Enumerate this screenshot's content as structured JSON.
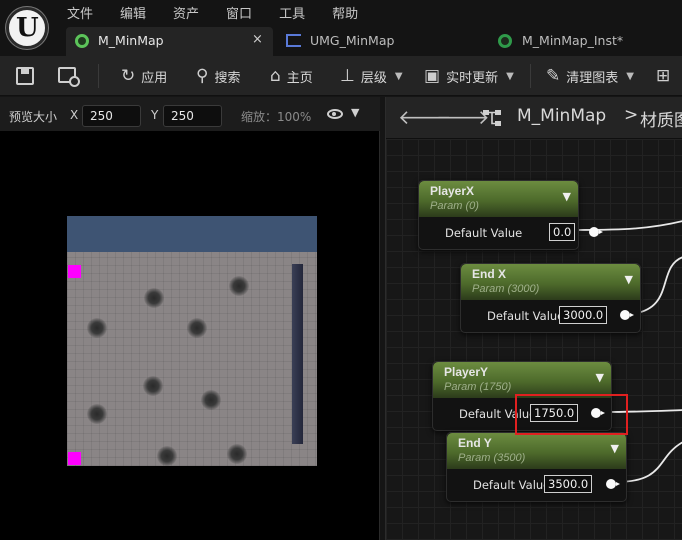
{
  "menu": [
    "文件",
    "编辑",
    "资产",
    "窗口",
    "工具",
    "帮助"
  ],
  "tabs": [
    {
      "label": "M_MinMap",
      "close": "×"
    },
    {
      "label": "UMG_MinMap"
    },
    {
      "label": "M_MinMap_Inst*"
    }
  ],
  "toolbar": {
    "apply": "应用",
    "search": "搜索",
    "home": "主页",
    "hierarchy": "层级",
    "live_update": "实时更新",
    "clean_graph": "清理图表"
  },
  "viewport": {
    "preview_size_label": "预览大小",
    "x_label": "X",
    "x_value": "250",
    "y_label": "Y",
    "y_value": "250",
    "zoom_label": "缩放：100%"
  },
  "graph": {
    "breadcrumb_asset": "M_MinMap",
    "breadcrumb_sep": ">",
    "breadcrumb_graph": "材质图"
  },
  "nodes": [
    {
      "name": "PlayerX",
      "sub": "Param (0)",
      "default_label": "Default Value",
      "value": "0.0"
    },
    {
      "name": "End X",
      "sub": "Param (3000)",
      "default_label": "Default Value",
      "value": "3000.0"
    },
    {
      "name": "PlayerY",
      "sub": "Param (1750)",
      "default_label": "Default Value",
      "value": "1750.0"
    },
    {
      "name": "End Y",
      "sub": "Param (3500)",
      "default_label": "Default Value",
      "value": "3500.0"
    }
  ],
  "colors": {
    "node_header": "#5a7a34",
    "highlight": "#e02020",
    "marker": "#ff00ff",
    "preview_sky": "#3e5473"
  }
}
